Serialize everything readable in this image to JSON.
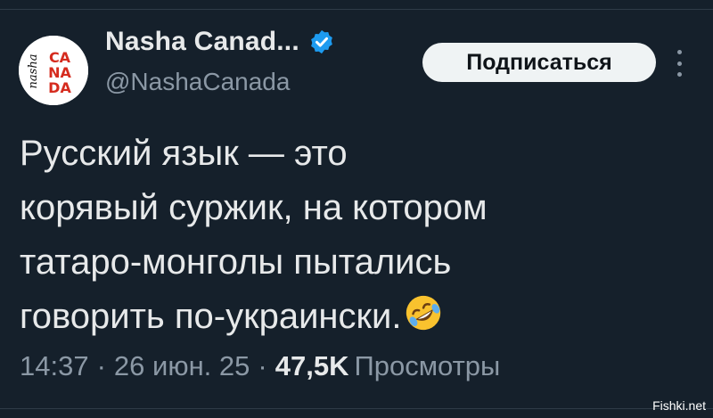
{
  "tweet": {
    "author": {
      "display_name": "Nasha Canad...",
      "handle": "@NashaCanada",
      "verified": true,
      "avatar_text": {
        "script": "nasha",
        "row1": "CA",
        "row2": "NA",
        "row3": "DA"
      }
    },
    "subscribe_label": "Подписаться",
    "text_lines": [
      "Русский язык — это",
      "корявый суржик, на котором",
      "татаро-монголы пытались",
      "говорить по-украински."
    ],
    "emoji_icon": "rolling-on-floor-laughing-emoji",
    "meta": {
      "time": "14:37",
      "date": "26 июн. 25",
      "separator": "·",
      "views_count": "47,5K",
      "views_label": "Просмотры"
    }
  },
  "watermark": "Fishki.net",
  "colors": {
    "background": "#15202b",
    "text": "#e7e9ea",
    "muted": "#8b98a5",
    "verified": "#1d9bf0",
    "button_bg": "#eff3f4",
    "brand_red": "#d52b1e"
  }
}
